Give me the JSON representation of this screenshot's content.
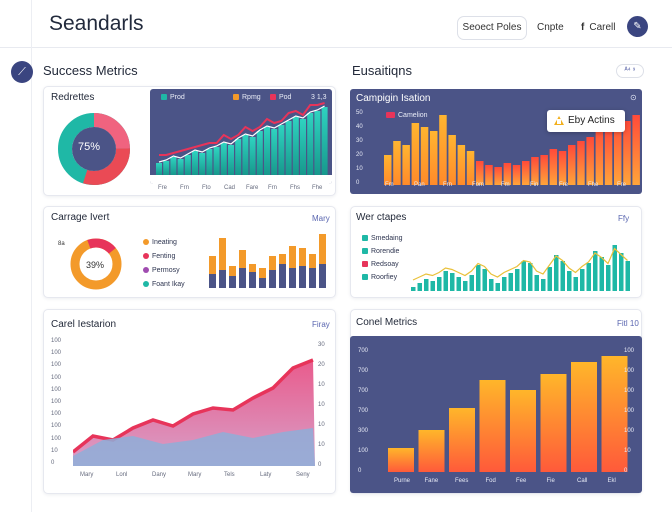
{
  "header": {
    "brand": "Seandarls",
    "select_button": "Seoect Poles",
    "link_1": "Cnpte",
    "link_2_icon": "facebook-icon",
    "link_2": "Carell",
    "avatar_icon": "user-icon"
  },
  "sidebar": {
    "icon": "chart-line-icon"
  },
  "sections": {
    "left_title": "Success Metrics",
    "right_title": "Eusaitiqns",
    "right_pill": "ᴬ⁴ ⁹"
  },
  "card_1": {
    "title": "Redrettes",
    "donut_label": "75%",
    "legend": [
      "Prod",
      "Rpmg",
      "Pod"
    ],
    "legend_value": "3 1,3",
    "x_ticks": [
      "Fre",
      "Frn",
      "Fto",
      "Cad",
      "Fare",
      "Frn",
      "Fhs",
      "Fhe"
    ]
  },
  "card_2": {
    "title": "Campigin Isation",
    "legend": "Camelion",
    "badge": "Eby Actins",
    "y_ticks": [
      "50",
      "40",
      "30",
      "20",
      "10",
      "0"
    ],
    "x_ticks": [
      "Fm",
      "Pan",
      "Frn",
      "Fom",
      "Fm",
      "Fin",
      "Fre",
      "Fhe",
      "Fre"
    ]
  },
  "card_3": {
    "title": "Carrage Ivert",
    "link": "Mary",
    "donut_label": "39%",
    "donut_side": "8a",
    "legend": [
      "Ineating",
      "Fenting",
      "Permosy",
      "Foant Ikay"
    ],
    "legend_colors": [
      "#f39a2a",
      "#e7345a",
      "#a04cb0",
      "#1fb8a6"
    ]
  },
  "card_4": {
    "title": "Wer ctapes",
    "link": "Ffy",
    "legend": [
      "Smedaing",
      "Rorendie",
      "Redsoay",
      "Roorfiey"
    ],
    "legend_colors": [
      "#1fb8a6",
      "#1fb8a6",
      "#e7345a",
      "#1fb8a6"
    ]
  },
  "card_5": {
    "title": "Carel Iestarion",
    "link": "Firay",
    "y_ticks": [
      "100",
      "100",
      "100",
      "100",
      "100",
      "100",
      "100",
      "100",
      "100",
      "10",
      "0"
    ],
    "y_right_ticks": [
      "30",
      "20",
      "10",
      "10",
      "10",
      "10",
      "0"
    ],
    "x_ticks": [
      "Mary",
      "Lonl",
      "Dany",
      "Mary",
      "Tels",
      "Laty",
      "Seny"
    ]
  },
  "card_6": {
    "title": "Conel Metrics",
    "link": "Fitl 10",
    "y_ticks": [
      "700",
      "700",
      "700",
      "700",
      "300",
      "100",
      "0"
    ],
    "y_right_ticks": [
      "100",
      "100",
      "100",
      "100",
      "100",
      "10",
      "0"
    ],
    "x_ticks": [
      "Purne",
      "Fane",
      "Fees",
      "Fod",
      "Fee",
      "Fie",
      "Call",
      "Ekl"
    ]
  },
  "colors": {
    "dark_panel": "#4b5487",
    "teal": "#1fb8a6",
    "coral": "#e7345a",
    "orange": "#f39a2a",
    "indigo": "#3a4580"
  }
}
